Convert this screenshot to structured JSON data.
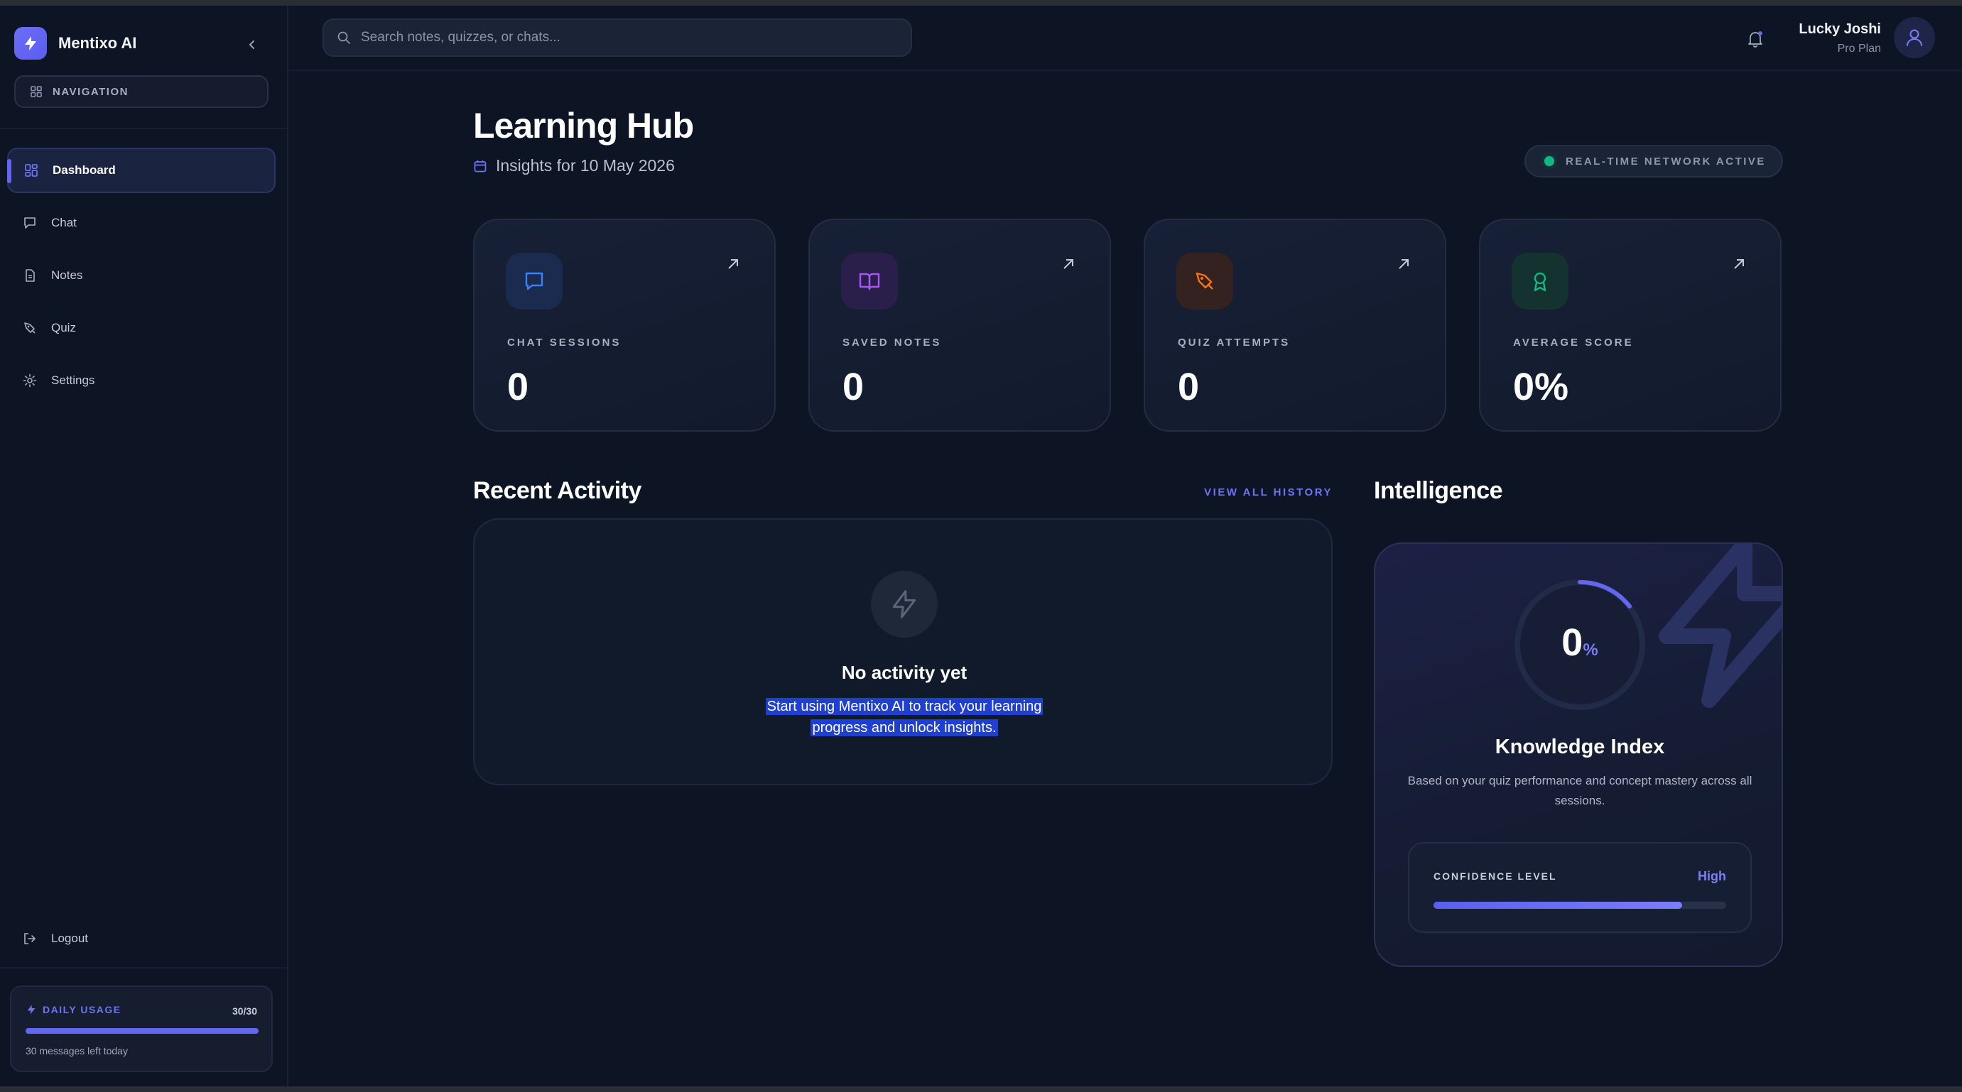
{
  "brand": {
    "name": "Mentixo AI"
  },
  "sidebar": {
    "nav_pill_label": "NAVIGATION",
    "items": [
      {
        "label": "Dashboard",
        "icon": "dashboard-icon",
        "active": true
      },
      {
        "label": "Chat",
        "icon": "chat-icon"
      },
      {
        "label": "Notes",
        "icon": "notes-icon"
      },
      {
        "label": "Quiz",
        "icon": "quiz-icon"
      },
      {
        "label": "Settings",
        "icon": "gear-icon"
      }
    ],
    "logout_label": "Logout",
    "usage": {
      "title": "DAILY USAGE",
      "count": "30/30",
      "fraction": 1.0,
      "note": "30 messages left today"
    }
  },
  "header": {
    "search_placeholder": "Search notes, quizzes, or chats...",
    "user_name": "Lucky Joshi",
    "user_plan": "Pro Plan"
  },
  "main": {
    "title": "Learning Hub",
    "date_text": "Insights for 10 May 2026",
    "status": "REAL-TIME NETWORK ACTIVE",
    "stats": [
      {
        "label": "CHAT SESSIONS",
        "value": "0",
        "icon": "chat-icon",
        "color": "#3b82f6"
      },
      {
        "label": "SAVED NOTES",
        "value": "0",
        "icon": "book-icon",
        "color": "#a855f7"
      },
      {
        "label": "QUIZ ATTEMPTS",
        "value": "0",
        "icon": "pen-icon",
        "color": "#f97316"
      },
      {
        "label": "AVERAGE SCORE",
        "value": "0%",
        "icon": "award-icon",
        "color": "#10b981"
      }
    ],
    "recent_activity": {
      "title": "Recent Activity",
      "view_all": "VIEW ALL HISTORY",
      "empty_title": "No activity yet",
      "empty_desc_line1": "Start using Mentixo AI to track your learning",
      "empty_desc_line2": "progress and unlock insights."
    },
    "intelligence": {
      "title": "Intelligence",
      "index_value": "0",
      "index_unit": "%",
      "card_title": "Knowledge Index",
      "card_desc": "Based on your quiz performance and concept mastery across all sessions.",
      "confidence_label": "CONFIDENCE LEVEL",
      "confidence_value": "High",
      "confidence_fraction": 0.85
    }
  },
  "colors": {
    "accent": "#6366f1",
    "background": "#0d1424"
  }
}
